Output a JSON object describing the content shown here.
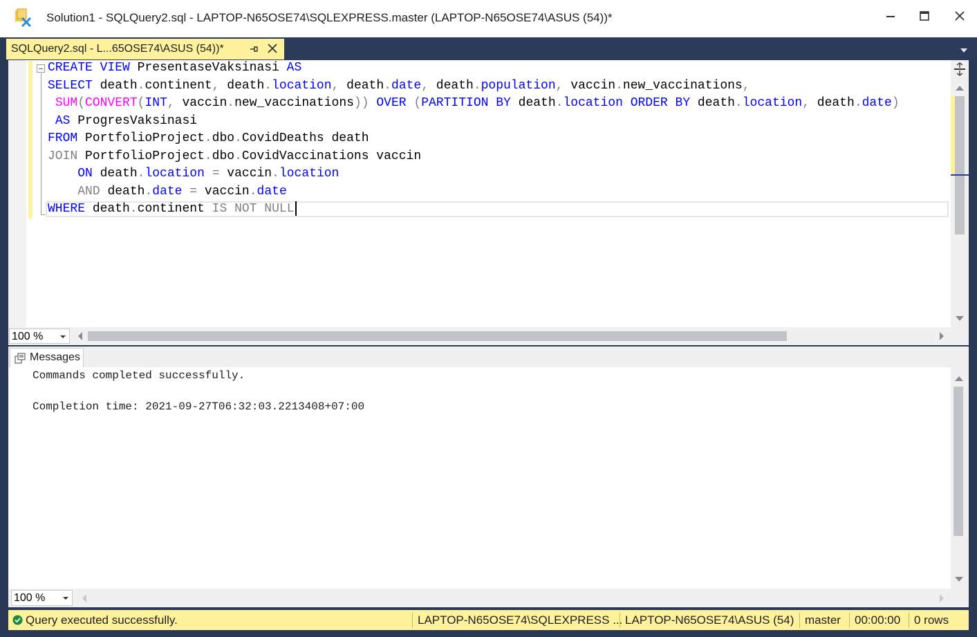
{
  "window": {
    "title": "Solution1 - SQLQuery2.sql - LAPTOP-N65OSE74\\SQLEXPRESS.master (LAPTOP-N65OSE74\\ASUS (54))*",
    "minimize_glyph": "—",
    "maximize_glyph": "☐",
    "close_glyph": "✕"
  },
  "tab": {
    "label": "SQLQuery2.sql - L...65OSE74\\ASUS (54))*"
  },
  "editor": {
    "zoom": "100 %",
    "lines": [
      [
        [
          "CREATE VIEW ",
          "kw"
        ],
        [
          "PresentaseVaksinasi ",
          ""
        ],
        [
          "AS",
          "kw"
        ]
      ],
      [
        [
          "SELECT ",
          "kw"
        ],
        [
          "death",
          ""
        ],
        [
          ".",
          "gr"
        ],
        [
          "continent",
          ""
        ],
        [
          ", ",
          "gr"
        ],
        [
          "death",
          ""
        ],
        [
          ".",
          "gr"
        ],
        [
          "location",
          "prop"
        ],
        [
          ", ",
          "gr"
        ],
        [
          "death",
          ""
        ],
        [
          ".",
          "gr"
        ],
        [
          "date",
          "prop"
        ],
        [
          ", ",
          "gr"
        ],
        [
          "death",
          ""
        ],
        [
          ".",
          "gr"
        ],
        [
          "population",
          "prop"
        ],
        [
          ", ",
          "gr"
        ],
        [
          "vaccin",
          ""
        ],
        [
          ".",
          "gr"
        ],
        [
          "new_vaccinations",
          ""
        ],
        [
          ",",
          "gr"
        ]
      ],
      [
        [
          " ",
          ""
        ],
        [
          "SUM",
          "fn"
        ],
        [
          "(",
          "gr"
        ],
        [
          "CONVERT",
          "fn"
        ],
        [
          "(",
          "gr"
        ],
        [
          "INT",
          "kw"
        ],
        [
          ", ",
          "gr"
        ],
        [
          "vaccin",
          ""
        ],
        [
          ".",
          "gr"
        ],
        [
          "new_vaccinations",
          ""
        ],
        [
          "))",
          "gr"
        ],
        [
          " ",
          ""
        ],
        [
          "OVER",
          "kw"
        ],
        [
          " ",
          ""
        ],
        [
          "(",
          "gr"
        ],
        [
          "PARTITION BY ",
          "kw"
        ],
        [
          "death",
          ""
        ],
        [
          ".",
          "gr"
        ],
        [
          "location",
          "prop"
        ],
        [
          " ",
          ""
        ],
        [
          "ORDER BY ",
          "kw"
        ],
        [
          "death",
          ""
        ],
        [
          ".",
          "gr"
        ],
        [
          "location",
          "prop"
        ],
        [
          ", ",
          "gr"
        ],
        [
          "death",
          ""
        ],
        [
          ".",
          "gr"
        ],
        [
          "date",
          "prop"
        ],
        [
          ")",
          "gr"
        ]
      ],
      [
        [
          " ",
          ""
        ],
        [
          "AS ",
          "kw"
        ],
        [
          "ProgresVaksinasi",
          ""
        ]
      ],
      [
        [
          "FROM ",
          "kw"
        ],
        [
          "PortfolioProject",
          ""
        ],
        [
          ".",
          "gr"
        ],
        [
          "dbo",
          ""
        ],
        [
          ".",
          "gr"
        ],
        [
          "CovidDeaths death",
          ""
        ]
      ],
      [
        [
          "JOIN ",
          "gr"
        ],
        [
          "PortfolioProject",
          ""
        ],
        [
          ".",
          "gr"
        ],
        [
          "dbo",
          ""
        ],
        [
          ".",
          "gr"
        ],
        [
          "CovidVaccinations vaccin",
          ""
        ]
      ],
      [
        [
          "    ",
          ""
        ],
        [
          "ON ",
          "kw"
        ],
        [
          "death",
          ""
        ],
        [
          ".",
          "gr"
        ],
        [
          "location",
          "prop"
        ],
        [
          " ",
          ""
        ],
        [
          "=",
          "gr"
        ],
        [
          " vaccin",
          ""
        ],
        [
          ".",
          "gr"
        ],
        [
          "location",
          "prop"
        ]
      ],
      [
        [
          "    ",
          ""
        ],
        [
          "AND ",
          "gr"
        ],
        [
          "death",
          ""
        ],
        [
          ".",
          "gr"
        ],
        [
          "date",
          "prop"
        ],
        [
          " ",
          ""
        ],
        [
          "=",
          "gr"
        ],
        [
          " vaccin",
          ""
        ],
        [
          ".",
          "gr"
        ],
        [
          "date",
          "prop"
        ]
      ],
      [
        [
          "WHERE ",
          "kw"
        ],
        [
          "death",
          ""
        ],
        [
          ".",
          "gr"
        ],
        [
          "continent ",
          ""
        ],
        [
          "IS NOT NULL",
          "gr"
        ]
      ]
    ]
  },
  "results": {
    "tab_label": "Messages",
    "zoom": "100 %",
    "lines": [
      "Commands completed successfully.",
      "",
      "Completion time: 2021-09-27T06:32:03.2213408+07:00"
    ]
  },
  "status": {
    "message": "Query executed successfully.",
    "server": "LAPTOP-N65OSE74\\SQLEXPRESS ...",
    "user": "LAPTOP-N65OSE74\\ASUS (54)",
    "database": "master",
    "elapsed": "00:00:00",
    "rows": "0 rows"
  },
  "colors": {
    "accent_yellow": "#fff29d",
    "frame": "#293955",
    "keyword": "#0000ff",
    "function": "#ff00ff",
    "operator": "#808080"
  }
}
